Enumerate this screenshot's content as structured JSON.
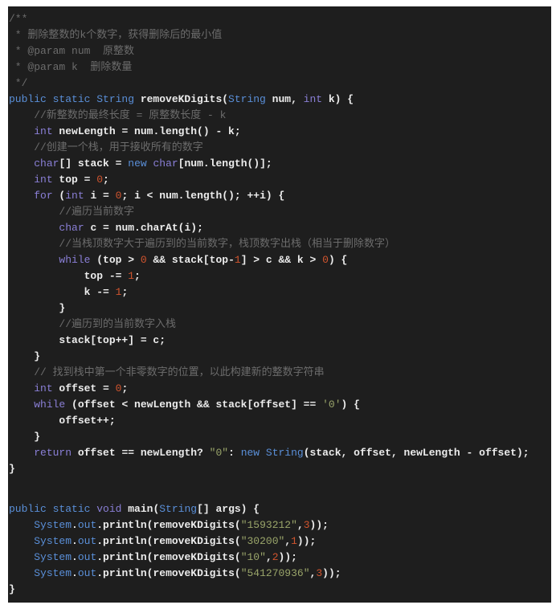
{
  "colors": {
    "background": "#1e1e1e",
    "comment": "#6c6c6c",
    "keyword": "#5a8fd8",
    "control": "#8a7fd6",
    "number": "#d0542e",
    "string": "#9aa56a",
    "text": "#ececec"
  },
  "code_lines": [
    [
      [
        "cm",
        "/**"
      ]
    ],
    [
      [
        "cm",
        " * 删除整数的k个数字，获得删除后的最小值"
      ]
    ],
    [
      [
        "cm",
        " * @param num  原整数"
      ]
    ],
    [
      [
        "cm",
        " * @param k  删除数量"
      ]
    ],
    [
      [
        "cm",
        " */"
      ]
    ],
    [
      [
        "kw",
        "public static String "
      ],
      [
        "p",
        "removeKDigits("
      ],
      [
        "kw",
        "String"
      ],
      [
        "p",
        " num, "
      ],
      [
        "kw2",
        "int"
      ],
      [
        "p",
        " k) {"
      ]
    ],
    [
      [
        "cm",
        "    //新整数的最终长度 = 原整数长度 - k"
      ]
    ],
    [
      [
        "p",
        "    "
      ],
      [
        "kw2",
        "int"
      ],
      [
        "p",
        " newLength = num.length() - k;"
      ]
    ],
    [
      [
        "cm",
        "    //创建一个栈，用于接收所有的数字"
      ]
    ],
    [
      [
        "p",
        "    "
      ],
      [
        "kw2",
        "char"
      ],
      [
        "p",
        "[] stack = "
      ],
      [
        "kw",
        "new"
      ],
      [
        "p",
        " "
      ],
      [
        "kw2",
        "char"
      ],
      [
        "p",
        "[num.length()];"
      ]
    ],
    [
      [
        "p",
        "    "
      ],
      [
        "kw2",
        "int"
      ],
      [
        "p",
        " top = "
      ],
      [
        "num",
        "0"
      ],
      [
        "p",
        ";"
      ]
    ],
    [
      [
        "p",
        "    "
      ],
      [
        "kw2",
        "for"
      ],
      [
        "p",
        " ("
      ],
      [
        "kw2",
        "int"
      ],
      [
        "p",
        " i = "
      ],
      [
        "num",
        "0"
      ],
      [
        "p",
        "; i < num.length(); ++i) {"
      ]
    ],
    [
      [
        "cm",
        "        //遍历当前数字"
      ]
    ],
    [
      [
        "p",
        "        "
      ],
      [
        "kw2",
        "char"
      ],
      [
        "p",
        " c = num.charAt(i);"
      ]
    ],
    [
      [
        "cm",
        "        //当栈顶数字大于遍历到的当前数字，栈顶数字出栈（相当于删除数字）"
      ]
    ],
    [
      [
        "p",
        "        "
      ],
      [
        "kw2",
        "while"
      ],
      [
        "p",
        " (top > "
      ],
      [
        "num",
        "0"
      ],
      [
        "p",
        " && stack[top-"
      ],
      [
        "num",
        "1"
      ],
      [
        "p",
        "] > c && k > "
      ],
      [
        "num",
        "0"
      ],
      [
        "p",
        ") {"
      ]
    ],
    [
      [
        "p",
        "            top -= "
      ],
      [
        "num",
        "1"
      ],
      [
        "p",
        ";"
      ]
    ],
    [
      [
        "p",
        "            k -= "
      ],
      [
        "num",
        "1"
      ],
      [
        "p",
        ";"
      ]
    ],
    [
      [
        "p",
        "        }"
      ]
    ],
    [
      [
        "cm",
        "        //遍历到的当前数字入栈"
      ]
    ],
    [
      [
        "p",
        "        stack[top++] = c;"
      ]
    ],
    [
      [
        "p",
        "    }"
      ]
    ],
    [
      [
        "cm",
        "    // 找到栈中第一个非零数字的位置，以此构建新的整数字符串"
      ]
    ],
    [
      [
        "p",
        "    "
      ],
      [
        "kw2",
        "int"
      ],
      [
        "p",
        " offset = "
      ],
      [
        "num",
        "0"
      ],
      [
        "p",
        ";"
      ]
    ],
    [
      [
        "p",
        "    "
      ],
      [
        "kw2",
        "while"
      ],
      [
        "p",
        " (offset < newLength && stack[offset] == "
      ],
      [
        "str",
        "'0'"
      ],
      [
        "p",
        ") {"
      ]
    ],
    [
      [
        "p",
        "        offset++;"
      ]
    ],
    [
      [
        "p",
        "    }"
      ]
    ],
    [
      [
        "p",
        "    "
      ],
      [
        "kw2",
        "return"
      ],
      [
        "p",
        " offset == newLength? "
      ],
      [
        "str",
        "\"0\""
      ],
      [
        "p",
        ": "
      ],
      [
        "kw",
        "new String"
      ],
      [
        "p",
        "(stack, offset, newLength - offset);"
      ]
    ],
    [
      [
        "p",
        "}"
      ]
    ],
    [],
    [
      [
        "kw",
        "public static "
      ],
      [
        "kw2",
        "void"
      ],
      [
        "p",
        " main("
      ],
      [
        "kw",
        "String"
      ],
      [
        "p",
        "[] args) {"
      ]
    ],
    [
      [
        "p",
        "    "
      ],
      [
        "fld",
        "System"
      ],
      [
        "p",
        "."
      ],
      [
        "fld",
        "out"
      ],
      [
        "p",
        ".println(removeKDigits("
      ],
      [
        "str",
        "\"1593212\""
      ],
      [
        "p",
        ","
      ],
      [
        "num",
        "3"
      ],
      [
        "p",
        "));"
      ]
    ],
    [
      [
        "p",
        "    "
      ],
      [
        "fld",
        "System"
      ],
      [
        "p",
        "."
      ],
      [
        "fld",
        "out"
      ],
      [
        "p",
        ".println(removeKDigits("
      ],
      [
        "str",
        "\"30200\""
      ],
      [
        "p",
        ","
      ],
      [
        "num",
        "1"
      ],
      [
        "p",
        "));"
      ]
    ],
    [
      [
        "p",
        "    "
      ],
      [
        "fld",
        "System"
      ],
      [
        "p",
        "."
      ],
      [
        "fld",
        "out"
      ],
      [
        "p",
        ".println(removeKDigits("
      ],
      [
        "str",
        "\"10\""
      ],
      [
        "p",
        ","
      ],
      [
        "num",
        "2"
      ],
      [
        "p",
        "));"
      ]
    ],
    [
      [
        "p",
        "    "
      ],
      [
        "fld",
        "System"
      ],
      [
        "p",
        "."
      ],
      [
        "fld",
        "out"
      ],
      [
        "p",
        ".println(removeKDigits("
      ],
      [
        "str",
        "\"541270936\""
      ],
      [
        "p",
        ","
      ],
      [
        "num",
        "3"
      ],
      [
        "p",
        "));"
      ]
    ],
    [
      [
        "p",
        "}"
      ]
    ]
  ]
}
